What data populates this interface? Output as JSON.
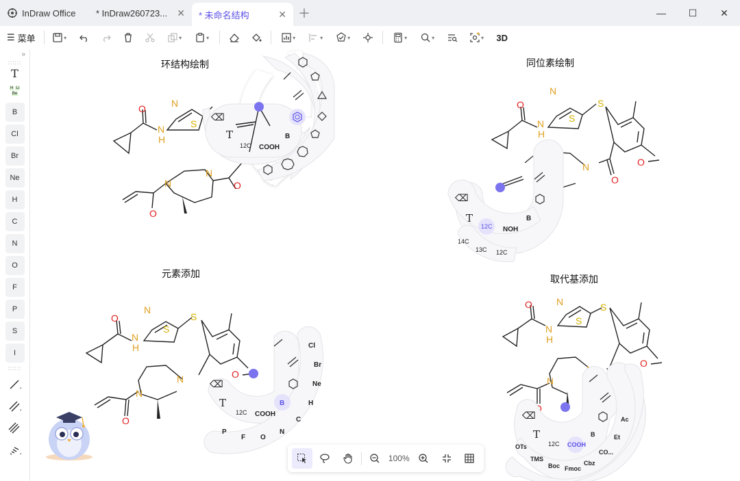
{
  "tabs": {
    "home": "InDraw Office",
    "doc1": "* InDraw260723...",
    "doc2": "* 未命名结构"
  },
  "toolbar": {
    "menu_label": "菜单",
    "three_d": "3D"
  },
  "sidebar": {
    "elements": [
      "B",
      "Cl",
      "Br",
      "Ne",
      "H",
      "C",
      "N",
      "O",
      "F",
      "P",
      "S",
      "I"
    ],
    "ptable": [
      "H",
      "Li",
      "Be"
    ]
  },
  "canvas": {
    "captions": {
      "ring": "环结构绘制",
      "isotope": "同位素绘制",
      "element": "元素添加",
      "substituent": "取代基添加"
    },
    "ring_menu": {
      "iso": "12C",
      "cooh": "COOH",
      "b": "B"
    },
    "isotope_menu": {
      "iso": "12C",
      "noh": "NOH",
      "b": "B",
      "sub1": "14C",
      "sub2": "13C",
      "sub3": "12C"
    },
    "element_menu": {
      "iso": "12C",
      "cooh": "COOH",
      "b": "B",
      "outer": [
        "Cl",
        "Br",
        "Ne",
        "H",
        "C",
        "N",
        "O",
        "F",
        "P"
      ]
    },
    "sub_menu": {
      "iso": "12C",
      "cooh": "COOH",
      "b": "B",
      "outer": [
        "Ac",
        "Et",
        "CO...",
        "Cbz",
        "Fmoc",
        "Boc",
        "TMS",
        "OTs"
      ]
    }
  },
  "bottombar": {
    "zoom": "100%"
  },
  "colors": {
    "accent": "#5b50e6",
    "oxygen": "#e02020",
    "nitrogen": "#e0a020",
    "sulfur": "#d4c000",
    "highlight": "#7b74ee"
  }
}
